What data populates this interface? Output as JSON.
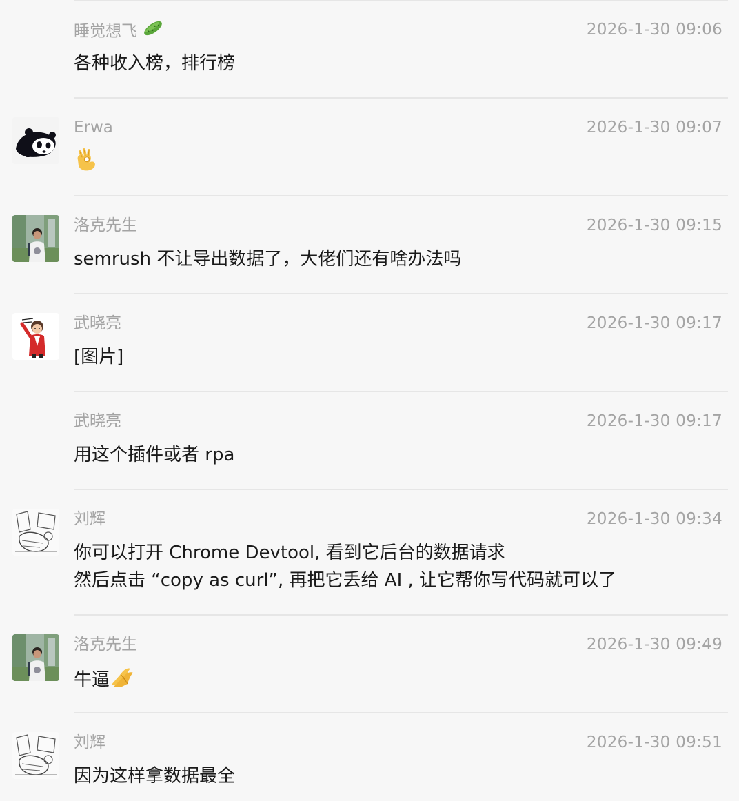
{
  "messages": [
    {
      "name": "睡觉想飞",
      "time": "2026-1-30 09:06",
      "lines": [
        "各种收入榜，排行榜"
      ],
      "name_emoji": "cucumber-emoji",
      "avatar": "none"
    },
    {
      "name": "Erwa",
      "time": "2026-1-30 09:07",
      "lines": [
        ""
      ],
      "body_emoji": "ok-hand-emoji",
      "avatar": "panda-avatar"
    },
    {
      "name": "洛克先生",
      "time": "2026-1-30 09:15",
      "lines": [
        "semrush 不让导出数据了，大佬们还有啥办法吗"
      ],
      "avatar": "photo-avatar"
    },
    {
      "name": "武晓亮",
      "time": "2026-1-30 09:17",
      "lines": [
        "[图片]"
      ],
      "avatar": "cartoon-avatar"
    },
    {
      "name": "武晓亮",
      "time": "2026-1-30 09:17",
      "lines": [
        "用这个插件或者 rpa"
      ],
      "avatar": "none"
    },
    {
      "name": "刘辉",
      "time": "2026-1-30 09:34",
      "lines": [
        "你可以打开 Chrome Devtool, 看到它后台的数据请求",
        "然后点击 “copy as curl”, 再把它丢给 AI , 让它帮你写代码就可以了"
      ],
      "avatar": "sketch-avatar"
    },
    {
      "name": "洛克先生",
      "time": "2026-1-30 09:49",
      "lines": [
        "牛逼"
      ],
      "body_emoji": "praying-hands-emoji",
      "avatar": "photo-avatar"
    },
    {
      "name": "刘辉",
      "time": "2026-1-30 09:51",
      "lines": [
        "因为这样拿数据最全"
      ],
      "avatar": "sketch-avatar"
    }
  ]
}
